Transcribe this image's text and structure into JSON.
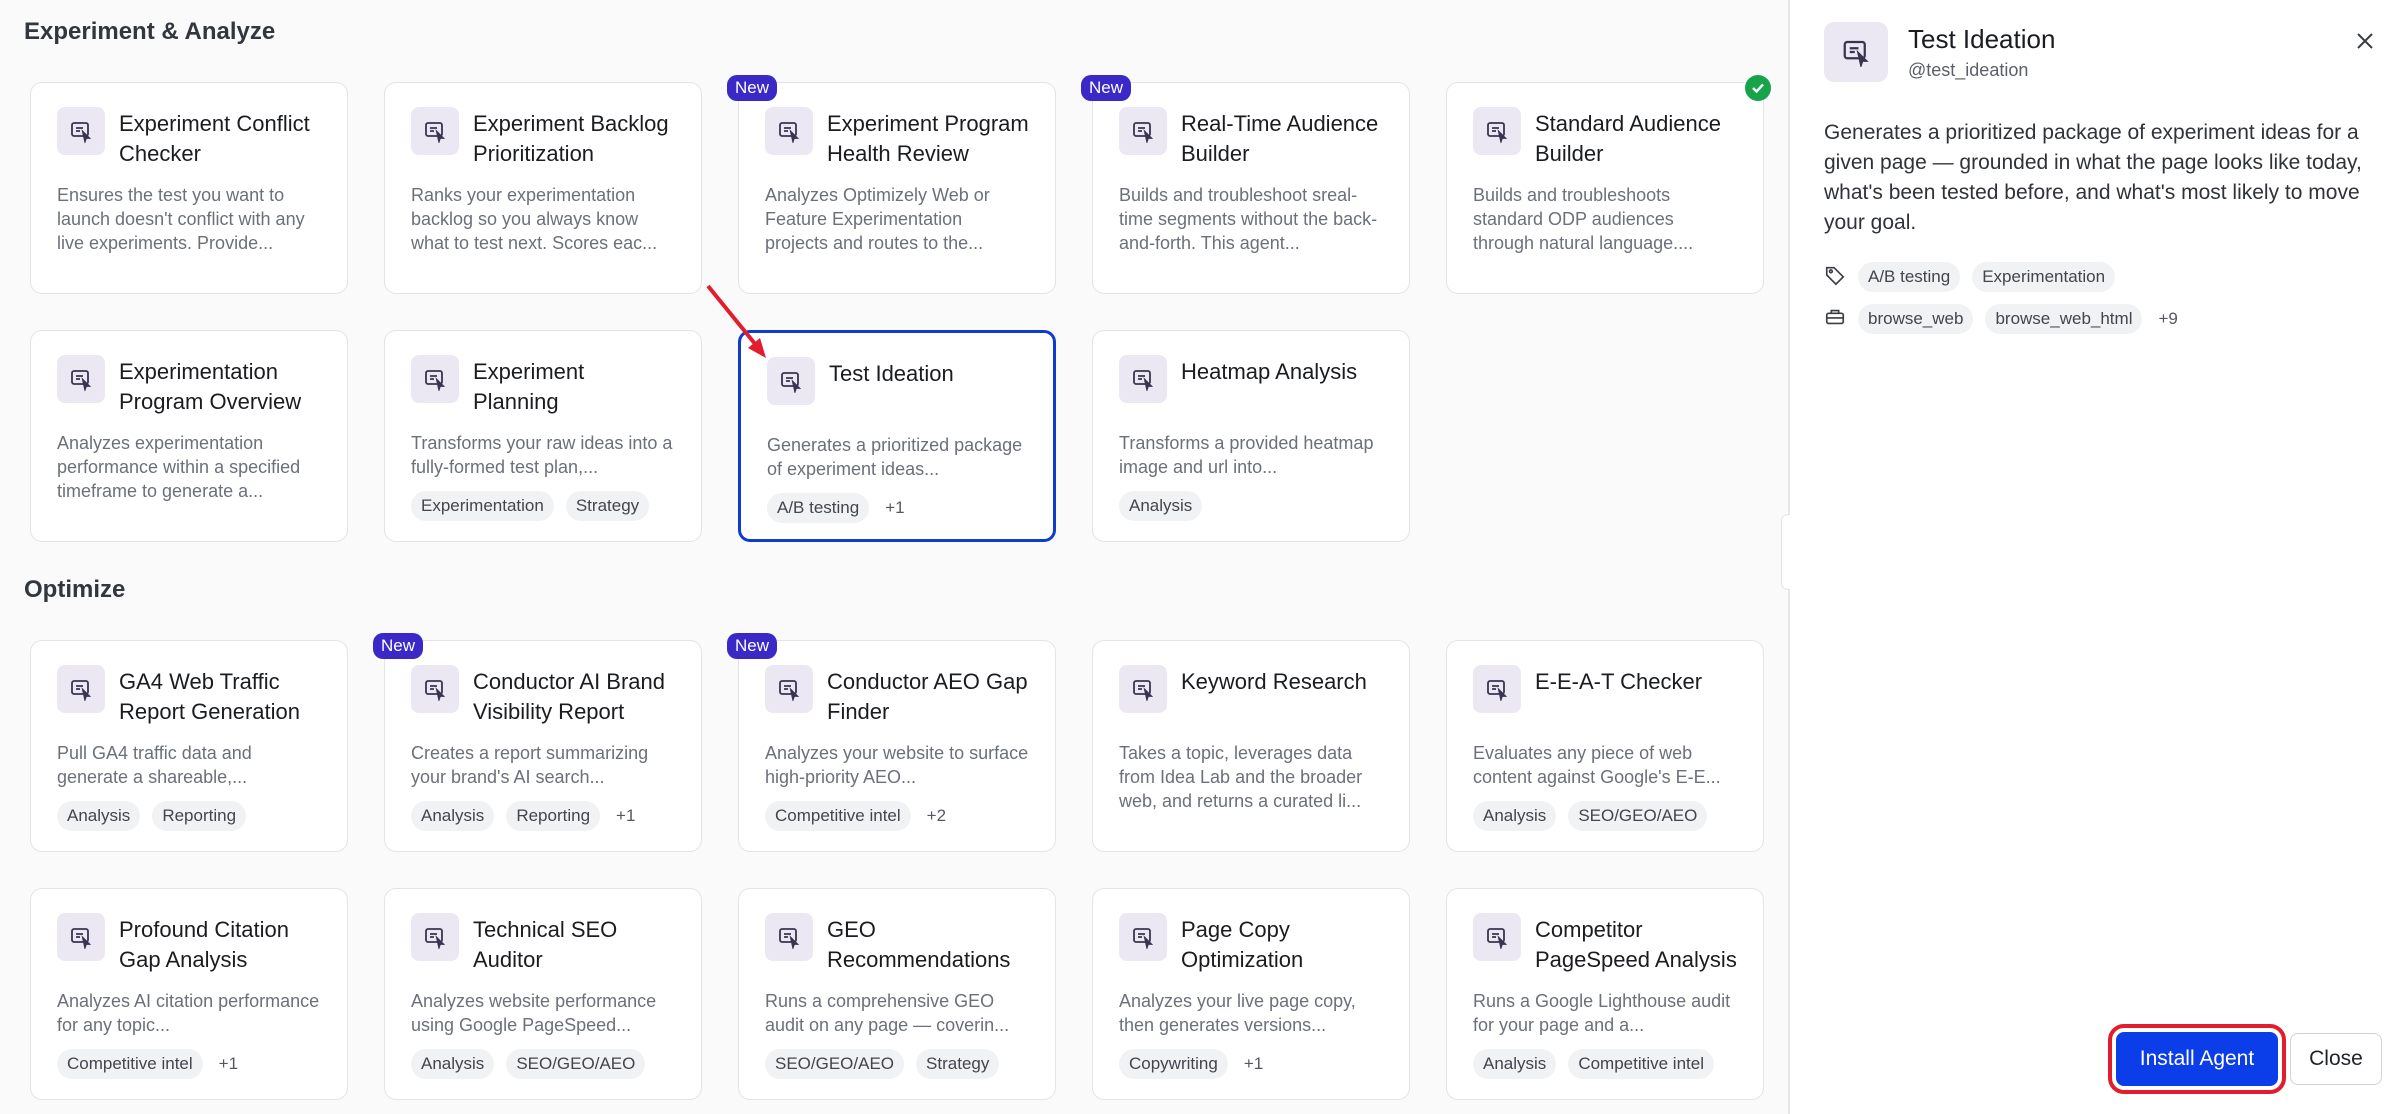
{
  "sections": [
    {
      "title": "Experiment & Analyze",
      "cards": [
        {
          "title": "Experiment Conflict Checker",
          "desc": "Ensures the test you want to launch doesn't conflict with any live experiments. Provide...",
          "tags": [],
          "more": "",
          "badge": ""
        },
        {
          "title": "Experiment Backlog Prioritization",
          "desc": "Ranks your experimentation backlog so you always know what to test next. Scores eac...",
          "tags": [],
          "more": "",
          "badge": ""
        },
        {
          "title": "Experiment Program Health Review",
          "desc": "Analyzes Optimizely Web or Feature Experimentation projects and routes to the...",
          "tags": [],
          "more": "",
          "badge": "New"
        },
        {
          "title": "Real-Time Audience Builder",
          "desc": "Builds and troubleshoot sreal-time segments without the back-and-forth. This agent...",
          "tags": [],
          "more": "",
          "badge": "New"
        },
        {
          "title": "Standard Audience Builder",
          "desc": "Builds and troubleshoots standard ODP audiences through natural language....",
          "tags": [],
          "more": "",
          "badge": "installed"
        },
        {
          "title": "Experimentation Program Overview",
          "desc": "Analyzes experimentation performance within a specified timeframe to generate a...",
          "tags": [],
          "more": "",
          "badge": ""
        },
        {
          "title": "Experiment Planning",
          "desc": "Transforms your raw ideas into a fully-formed test plan,...",
          "tags": [
            "Experimentation",
            "Strategy"
          ],
          "more": "",
          "badge": ""
        },
        {
          "title": "Test Ideation",
          "desc": "Generates a prioritized package of experiment ideas...",
          "tags": [
            "A/B testing"
          ],
          "more": "+1",
          "badge": "",
          "selected": true
        },
        {
          "title": "Heatmap Analysis",
          "desc": "Transforms a provided heatmap image and url into...",
          "tags": [
            "Analysis"
          ],
          "more": "",
          "badge": ""
        }
      ]
    },
    {
      "title": "Optimize",
      "cards": [
        {
          "title": "GA4 Web Traffic Report Generation",
          "desc": "Pull GA4 traffic data and generate a shareable,...",
          "tags": [
            "Analysis",
            "Reporting"
          ],
          "more": "",
          "badge": ""
        },
        {
          "title": "Conductor AI Brand Visibility Report",
          "desc": "Creates a report summarizing your brand's AI search...",
          "tags": [
            "Analysis",
            "Reporting"
          ],
          "more": "+1",
          "badge": "New"
        },
        {
          "title": "Conductor AEO Gap Finder",
          "desc": "Analyzes your website to surface high-priority AEO...",
          "tags": [
            "Competitive intel"
          ],
          "more": "+2",
          "badge": "New"
        },
        {
          "title": "Keyword Research",
          "desc": "Takes a topic, leverages data from Idea Lab and the broader web, and returns a curated li...",
          "tags": [],
          "more": "",
          "badge": ""
        },
        {
          "title": "E-E-A-T Checker",
          "desc": "Evaluates any piece of web content against Google's E-E...",
          "tags": [
            "Analysis",
            "SEO/GEO/AEO"
          ],
          "more": "",
          "badge": ""
        },
        {
          "title": "Profound Citation Gap Analysis",
          "desc": "Analyzes AI citation performance for any topic...",
          "tags": [
            "Competitive intel"
          ],
          "more": "+1",
          "badge": ""
        },
        {
          "title": "Technical SEO Auditor",
          "desc": "Analyzes website performance using Google PageSpeed...",
          "tags": [
            "Analysis",
            "SEO/GEO/AEO"
          ],
          "more": "",
          "badge": ""
        },
        {
          "title": "GEO Recommendations",
          "desc": "Runs a comprehensive GEO audit on any page — coverin...",
          "tags": [
            "SEO/GEO/AEO",
            "Strategy"
          ],
          "more": "",
          "badge": ""
        },
        {
          "title": "Page Copy Optimization",
          "desc": "Analyzes your live page copy, then generates versions...",
          "tags": [
            "Copywriting"
          ],
          "more": "+1",
          "badge": ""
        },
        {
          "title": "Competitor PageSpeed Analysis",
          "desc": "Runs a Google Lighthouse audit for your page and a...",
          "tags": [
            "Analysis",
            "Competitive intel"
          ],
          "more": "",
          "badge": ""
        }
      ]
    }
  ],
  "panel": {
    "title": "Test Ideation",
    "handle": "@test_ideation",
    "description": "Generates a prioritized package of experiment ideas for a given page — grounded in what the page looks like today, what's been tested before, and what's most likely to move your goal.",
    "tags": [
      "A/B testing",
      "Experimentation"
    ],
    "tools": [
      "browse_web",
      "browse_web_html"
    ],
    "tools_more": "+9",
    "install_label": "Install Agent",
    "close_label": "Close"
  }
}
